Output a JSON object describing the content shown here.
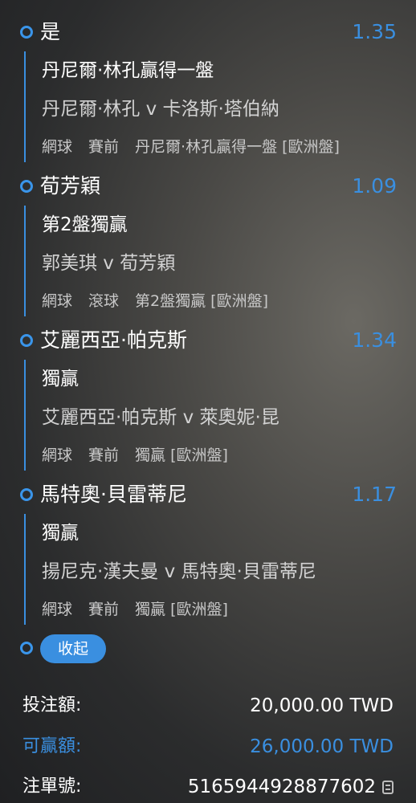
{
  "selections": [
    {
      "pick": "是",
      "odds": "1.35",
      "market": "丹尼爾·林孔贏得一盤",
      "event": "丹尼爾·林孔 v 卡洛斯·塔伯納",
      "meta": [
        "網球",
        "賽前",
        "丹尼爾·林孔贏得一盤 [歐洲盤]"
      ]
    },
    {
      "pick": "荀芳穎",
      "odds": "1.09",
      "market": "第2盤獨贏",
      "event": "郭美琪 v 荀芳穎",
      "meta": [
        "網球",
        "滾球",
        "第2盤獨贏 [歐洲盤]"
      ]
    },
    {
      "pick": "艾麗西亞·帕克斯",
      "odds": "1.34",
      "market": "獨贏",
      "event": "艾麗西亞·帕克斯 v 萊奧妮·昆",
      "meta": [
        "網球",
        "賽前",
        "獨贏 [歐洲盤]"
      ]
    },
    {
      "pick": "馬特奧·貝雷蒂尼",
      "odds": "1.17",
      "market": "獨贏",
      "event": "揚尼克·漢夫曼 v 馬特奧·貝雷蒂尼",
      "meta": [
        "網球",
        "賽前",
        "獨贏 [歐洲盤]"
      ]
    }
  ],
  "collapse_label": "收起",
  "summary": {
    "stake_label": "投注額:",
    "stake_value": "20,000.00 TWD",
    "win_label": "可贏額:",
    "win_value": "26,000.00 TWD",
    "ticket_label": "注單號:",
    "ticket_value": "5165944928877602"
  },
  "colors": {
    "accent": "#3a8fe0",
    "text": "#ffffff",
    "muted": "#c8c8c8"
  },
  "icons": {
    "radio": "radio-dot-icon",
    "copy": "copy-icon"
  }
}
